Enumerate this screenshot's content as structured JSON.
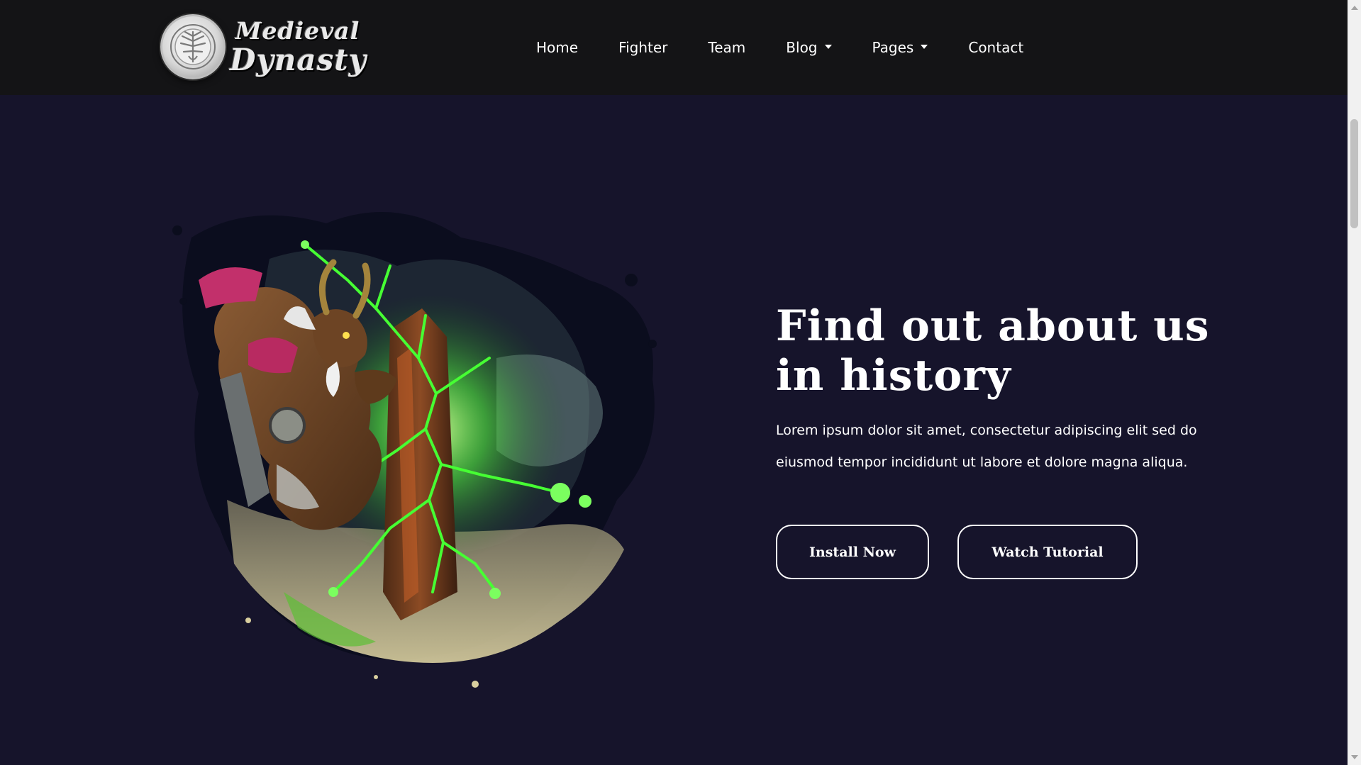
{
  "brand": {
    "logo_line1": "Medieval",
    "logo_line2": "Dynasty"
  },
  "nav": {
    "items": [
      {
        "label": "Home"
      },
      {
        "label": "Fighter"
      },
      {
        "label": "Team"
      },
      {
        "label": "Blog"
      },
      {
        "label": "Pages"
      },
      {
        "label": "Contact"
      }
    ]
  },
  "hero": {
    "title_line1": "Find out about us",
    "title_line2": "in history",
    "description_line1": "Lorem ipsum dolor sit amet, consectetur adipiscing elit sed do",
    "description_line2": "eiusmod tempor incididunt ut labore et dolore magna aliqua.",
    "install_label": "Install Now",
    "watch_label": "Watch Tutorial"
  },
  "colors": {
    "header_bg": "#141416",
    "page_bg": "#16142b",
    "accent_green": "#39ff3a",
    "text": "#ffffff"
  },
  "icons": {
    "logo": "medallion-icon",
    "dropdown": "chevron-down-icon"
  }
}
